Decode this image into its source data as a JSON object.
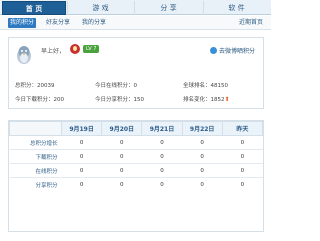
{
  "tabs": [
    {
      "label": "首 页",
      "active": true
    },
    {
      "label": "游 戏",
      "active": false
    },
    {
      "label": "分 享",
      "active": false
    },
    {
      "label": "软 件",
      "active": false
    }
  ],
  "subnav": {
    "items": [
      {
        "label": "我的积分",
        "active": true
      },
      {
        "label": "好友分享",
        "active": false
      },
      {
        "label": "我的分享",
        "active": false
      }
    ],
    "recent_home": "近期首页"
  },
  "profile": {
    "username": "早上好，",
    "level": "LV 7",
    "share_link": "去微博晒积分",
    "stats": {
      "total_points": "总积分：20039",
      "today_online": "今日在线积分：0",
      "global_rank": "全球排名：48150",
      "today_download": "今日下载积分：200",
      "today_share": "今日分享积分：150",
      "rank_change": "排名变化：1852"
    },
    "colors": {
      "level_badge": "#4aa23c",
      "rank_up": "#e05a1a"
    }
  },
  "table": {
    "columns": [
      "9月19日",
      "9月20日",
      "9月21日",
      "9月22日",
      "昨天"
    ],
    "rows": [
      {
        "label": "总积分增长",
        "values": [
          "0",
          "0",
          "0",
          "0",
          "0"
        ]
      },
      {
        "label": "下载积分",
        "values": [
          "0",
          "0",
          "0",
          "0",
          "0"
        ]
      },
      {
        "label": "在线积分",
        "values": [
          "0",
          "0",
          "0",
          "0",
          "0"
        ]
      },
      {
        "label": "分享积分",
        "values": [
          "0",
          "0",
          "0",
          "0",
          "0"
        ]
      }
    ]
  },
  "theme": {
    "accent": "#1f5f97",
    "link": "#2e5b83"
  }
}
